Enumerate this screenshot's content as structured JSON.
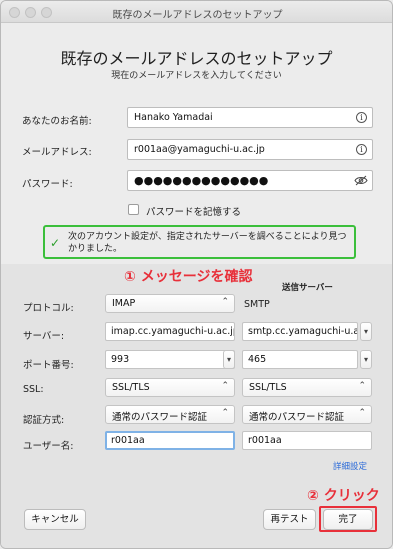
{
  "window": {
    "title": "既存のメールアドレスのセットアップ"
  },
  "header": {
    "heading": "既存のメールアドレスのセットアップ",
    "subheading": "現在のメールアドレスを入力してください"
  },
  "form": {
    "name_label": "あなたのお名前:",
    "name_value": "Hanako Yamadai",
    "email_label": "メールアドレス:",
    "email_value": "r001aa@yamaguchi-u.ac.jp",
    "password_label": "パスワード:",
    "password_value": "●●●●●●●●●●●●●●",
    "remember_label": "パスワードを記憶する"
  },
  "status": {
    "message": "次のアカウント設定が、指定されたサーバーを調べることにより見つかりました。"
  },
  "annotations": {
    "step1": "① メッセージを確認",
    "step2": "② クリック"
  },
  "server": {
    "outgoing_header": "送信サーバー",
    "protocol_label": "プロトコル:",
    "incoming_protocol": "IMAP",
    "outgoing_protocol": "SMTP",
    "server_label": "サーバー:",
    "incoming_server": "imap.cc.yamaguchi-u.ac.jp",
    "outgoing_server": "smtp.cc.yamaguchi-u.ac.jp",
    "port_label": "ポート番号:",
    "incoming_port": "993",
    "outgoing_port": "465",
    "ssl_label": "SSL:",
    "incoming_ssl": "SSL/TLS",
    "outgoing_ssl": "SSL/TLS",
    "auth_label": "認証方式:",
    "incoming_auth": "通常のパスワード認証",
    "outgoing_auth": "通常のパスワード認証",
    "user_label": "ユーザー名:",
    "incoming_user": "r001aa",
    "outgoing_user": "r001aa",
    "advanced_link": "詳細設定"
  },
  "buttons": {
    "cancel": "キャンセル",
    "retest": "再テスト",
    "done": "完了"
  },
  "colors": {
    "annotation_red": "#e8303a",
    "success_green": "#3bbf3b",
    "link_blue": "#2a6ad8",
    "focus_blue": "#7fb2e6"
  },
  "icons": {
    "info": "info-circle-icon",
    "eye": "eye-slash-icon",
    "check": "check-icon",
    "chevron": "chevron-updown-icon"
  }
}
